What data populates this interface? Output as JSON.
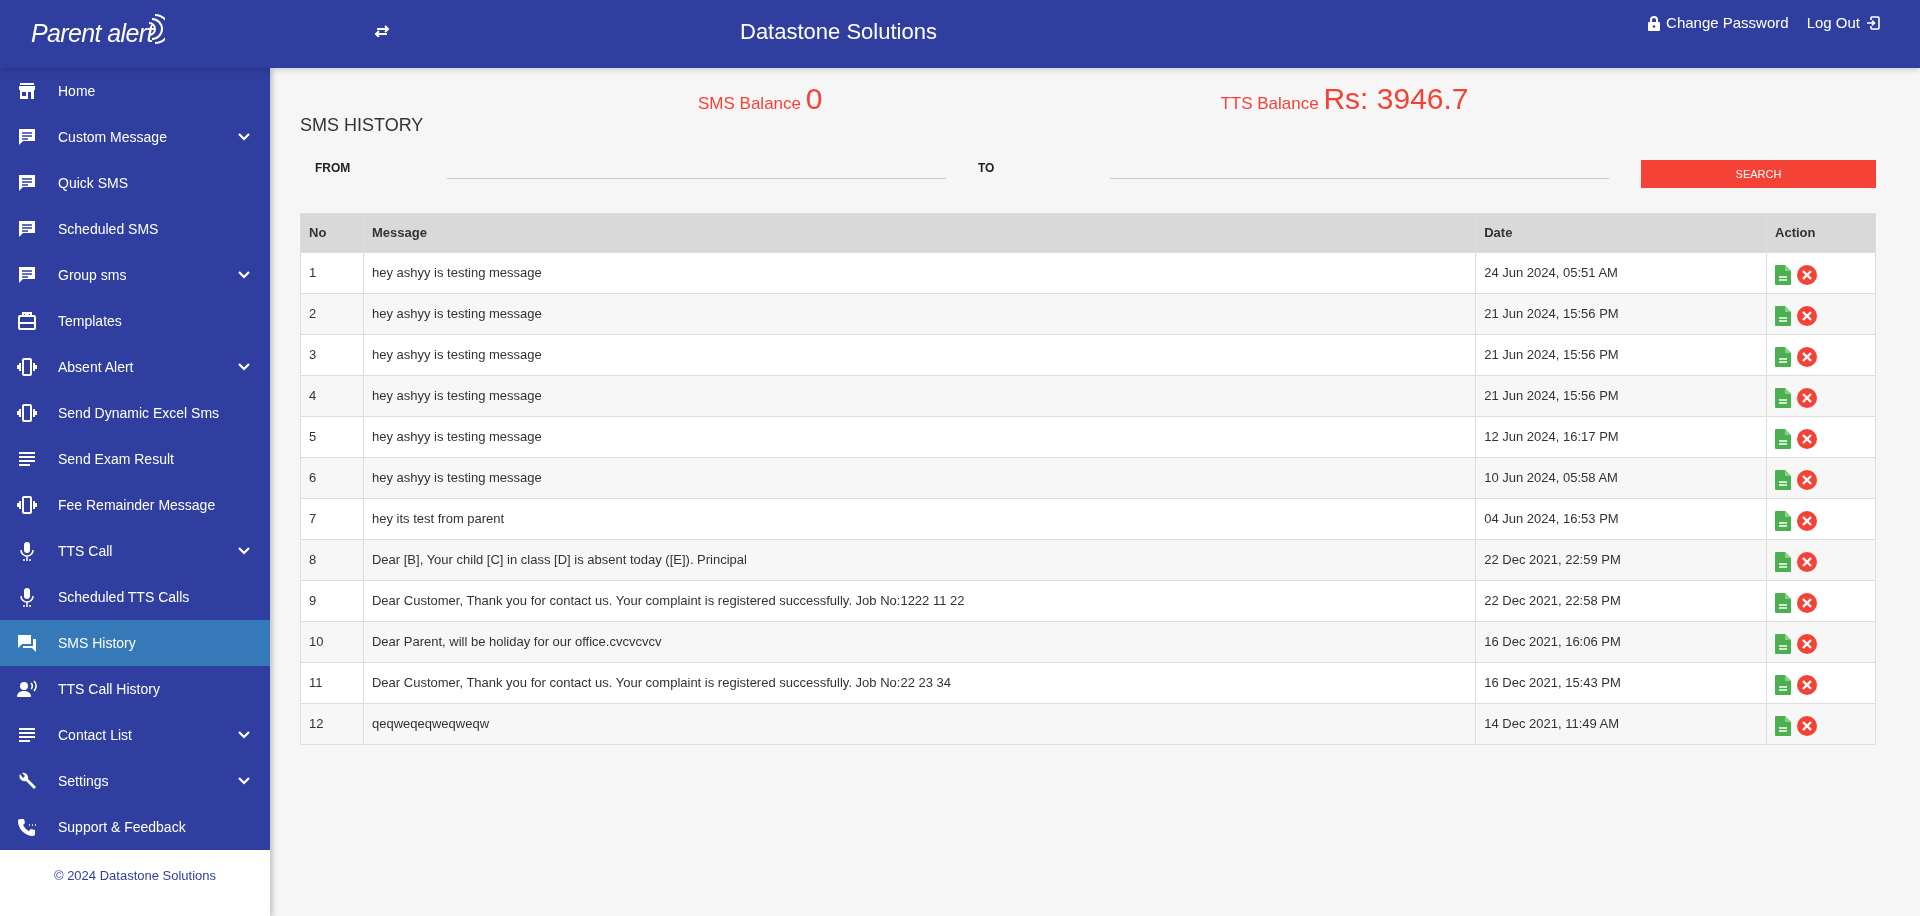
{
  "header": {
    "logo": "Parent alert",
    "title": "Datastone Solutions",
    "links": [
      {
        "label": "Change Password",
        "kind": "lock"
      },
      {
        "label": "Log Out",
        "kind": "logout"
      }
    ]
  },
  "sidebar": {
    "items": [
      {
        "label": "Home",
        "kind": "link",
        "selected": false
      },
      {
        "label": "Custom Message",
        "kind": "group",
        "selected": false
      },
      {
        "label": "Quick SMS",
        "kind": "link",
        "selected": false
      },
      {
        "label": "Scheduled SMS",
        "kind": "link",
        "selected": false
      },
      {
        "label": "Group sms",
        "kind": "group",
        "selected": false
      },
      {
        "label": "Templates",
        "kind": "link",
        "selected": false
      },
      {
        "label": "Absent Alert",
        "kind": "group",
        "selected": false
      },
      {
        "label": "Send Dynamic Excel Sms",
        "kind": "link",
        "selected": false
      },
      {
        "label": "Send Exam Result",
        "kind": "link",
        "selected": false
      },
      {
        "label": "Fee Remainder Message",
        "kind": "link",
        "selected": false
      },
      {
        "label": "TTS Call",
        "kind": "group",
        "selected": false
      },
      {
        "label": "Scheduled TTS Calls",
        "kind": "link",
        "selected": false
      },
      {
        "label": "SMS History",
        "kind": "link",
        "selected": true
      },
      {
        "label": "TTS Call History",
        "kind": "link",
        "selected": false
      },
      {
        "label": "Contact List",
        "kind": "group",
        "selected": false
      },
      {
        "label": "Settings",
        "kind": "group",
        "selected": false
      },
      {
        "label": "Support & Feedback",
        "kind": "link",
        "selected": false
      }
    ],
    "footer": "© 2024 Datastone Solutions"
  },
  "balances": [
    {
      "label": "SMS Balance",
      "value": "0"
    },
    {
      "label": "TTS Balance",
      "value": "Rs: 3946.7"
    }
  ],
  "page_title": "SMS HISTORY",
  "filters": {
    "from_label": "FROM",
    "to_label": "TO",
    "search_button": "SEARCH"
  },
  "table": {
    "columns": [
      "No",
      "Message",
      "Date",
      "Action"
    ],
    "rows": [
      {
        "no": "1",
        "message": "hey ashyy is testing message",
        "date": "24 Jun 2024, 05:51 AM"
      },
      {
        "no": "2",
        "message": "hey ashyy is testing message",
        "date": "21 Jun 2024, 15:56 PM"
      },
      {
        "no": "3",
        "message": "hey ashyy is testing message",
        "date": "21 Jun 2024, 15:56 PM"
      },
      {
        "no": "4",
        "message": "hey ashyy is testing message",
        "date": "21 Jun 2024, 15:56 PM"
      },
      {
        "no": "5",
        "message": "hey ashyy is testing message",
        "date": "12 Jun 2024, 16:17 PM"
      },
      {
        "no": "6",
        "message": "hey ashyy is testing message",
        "date": "10 Jun 2024, 05:58 AM"
      },
      {
        "no": "7",
        "message": "hey its test from parent",
        "date": "04 Jun 2024, 16:53 PM"
      },
      {
        "no": "8",
        "message": "Dear [B], Your child [C] in class [D] is absent today ([E]). Principal",
        "date": "22 Dec 2021, 22:59 PM"
      },
      {
        "no": "9",
        "message": "Dear Customer, Thank you for contact us. Your complaint is registered successfully. Job No:1222 11 22",
        "date": "22 Dec 2021, 22:58 PM"
      },
      {
        "no": "10",
        "message": "Dear Parent, will be holiday for our office.cvcvcvcv",
        "date": "16 Dec 2021, 16:06 PM"
      },
      {
        "no": "11",
        "message": "Dear Customer, Thank you for contact us. Your complaint is registered successfully. Job No:22 23 34",
        "date": "16 Dec 2021, 15:43 PM"
      },
      {
        "no": "12",
        "message": "qeqweqeqweqweqw",
        "date": "14 Dec 2021, 11:49 AM"
      }
    ]
  }
}
